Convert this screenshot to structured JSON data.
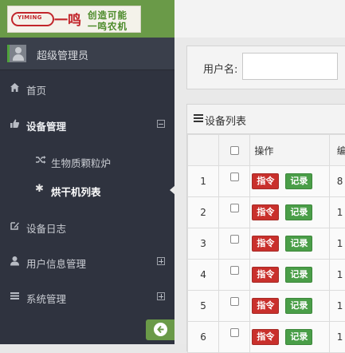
{
  "logo": {
    "pill_text": "YIMING",
    "mark_text": "一鸣",
    "line1": "创造可能",
    "line2": "一鸣农机"
  },
  "user": {
    "name": "超级管理员"
  },
  "nav": {
    "home": "首页",
    "device_mgmt": "设备管理",
    "sub_items": [
      {
        "label": "生物质颗粒炉",
        "icon": "shuffle-icon"
      },
      {
        "label": "烘干机列表",
        "icon": "asterisk-icon"
      }
    ],
    "device_log": "设备日志",
    "user_info": "用户信息管理",
    "system": "系统管理"
  },
  "search": {
    "label": "用户名:",
    "value": ""
  },
  "device_list": {
    "title": "设备列表",
    "headers": {
      "index": "",
      "ops": "操作",
      "extra": "编"
    },
    "buttons": {
      "command": "指令",
      "record": "记录"
    },
    "rows": [
      {
        "index": "1",
        "extra": "8"
      },
      {
        "index": "2",
        "extra": "1"
      },
      {
        "index": "3",
        "extra": "1"
      },
      {
        "index": "4",
        "extra": "1"
      },
      {
        "index": "5",
        "extra": "1"
      },
      {
        "index": "6",
        "extra": "1"
      }
    ]
  },
  "colors": {
    "accent_green": "#6a9a48",
    "sidebar": "#2f333f",
    "danger": "#c9302c",
    "success": "#4a9e48"
  }
}
